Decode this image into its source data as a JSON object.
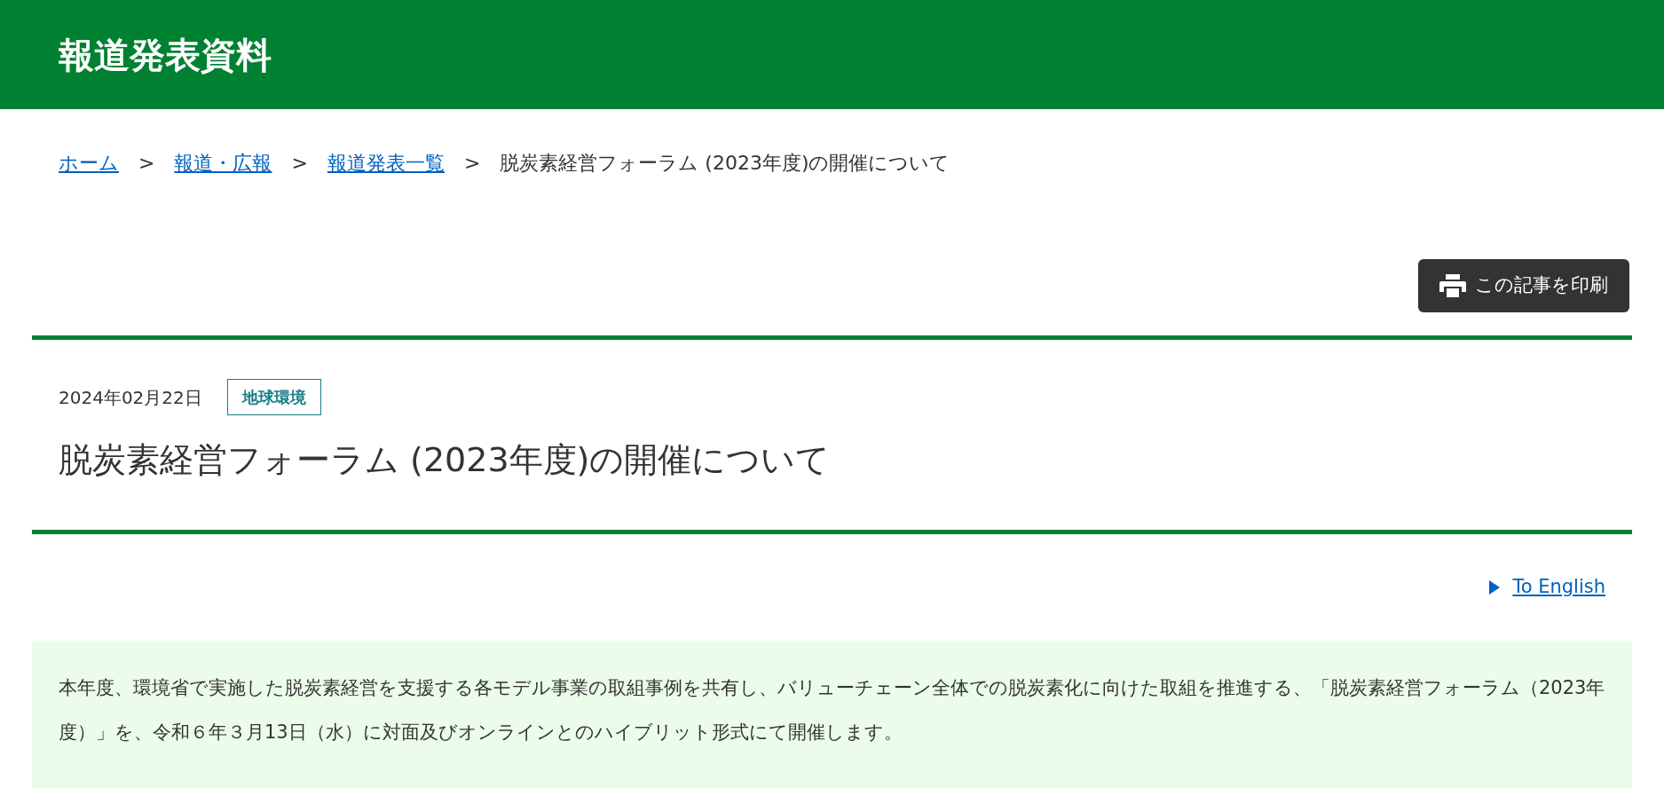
{
  "header": {
    "title": "報道発表資料"
  },
  "breadcrumb": [
    {
      "label": "ホーム",
      "link": true
    },
    {
      "label": "報道・広報",
      "link": true
    },
    {
      "label": "報道発表一覧",
      "link": true
    },
    {
      "label": "脱炭素経営フォーラム (2023年度)の開催について",
      "link": false
    }
  ],
  "breadcrumb_separator": ">",
  "print_button": {
    "label": "この記事を印刷"
  },
  "article": {
    "date": "2024年02月22日",
    "tag": "地球環境",
    "title": "脱炭素経営フォーラム (2023年度)の開催について"
  },
  "language_link": {
    "label": "To English"
  },
  "summary": "本年度、環境省で実施した脱炭素経営を支援する各モデル事業の取組事例を共有し、バリューチェーン全体での脱炭素化に向けた取組を推進する、「脱炭素経営フォーラム（2023年度）」を、令和６年３月13日（水）に対面及びオンラインとのハイブリット形式にて開催します。"
}
